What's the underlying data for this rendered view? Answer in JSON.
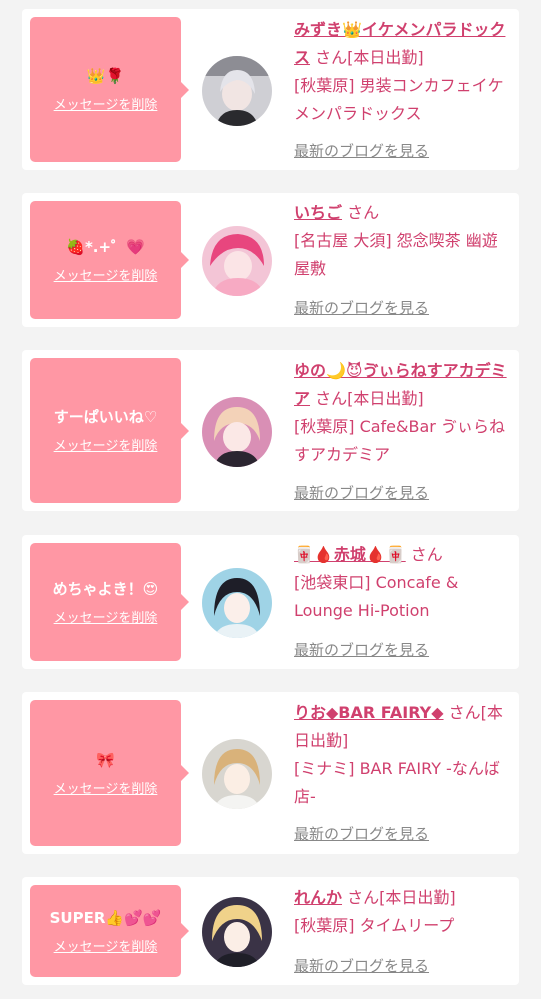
{
  "delete_label": "メッセージを削除",
  "blog_label": "最新のブログを見る",
  "san_label": "さん",
  "colors": {
    "accent": "#d0406e",
    "bubble": "#ff97a4",
    "page_bg": "#f3f3f3",
    "card_bg": "#ffffff",
    "link_gray": "#888888"
  },
  "cards": [
    {
      "message": "👑🌹",
      "name": "みずき👑イケメンパラドックス",
      "suffix": "[本日出勤]",
      "place": "[秋葉原] 男装コンカフェイケメンパラドックス"
    },
    {
      "message": "🍓*.+゜💗",
      "name": "いちご",
      "suffix": "",
      "place": "[名古屋 大須] 怨念喫茶 幽遊屋敷"
    },
    {
      "message": "すーぱいいね♡",
      "name": "ゆの🌙😈ゔぃらねすアカデミア",
      "suffix": "[本日出勤]",
      "place": "[秋葉原] Cafe&Bar ゔぃらねすアカデミア"
    },
    {
      "message": "めちゃよき！😍",
      "name": "🀄🩸赤城🩸🀄",
      "suffix": "",
      "place": "[池袋東口] Concafe & Lounge Hi-Potion"
    },
    {
      "message": "🎀",
      "name": "りお◆BAR FAIRY◆",
      "suffix": "[本日出勤]",
      "place": "[ミナミ] BAR FAIRY -なんば店-"
    },
    {
      "message": "SUPER👍💕💕",
      "name": "れんか",
      "suffix": "[本日出勤]",
      "place": "[秋葉原] タイムリープ"
    }
  ]
}
